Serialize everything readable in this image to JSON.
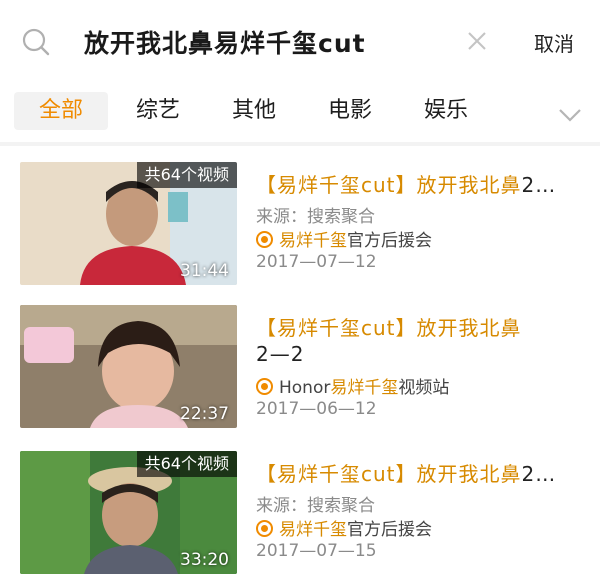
{
  "search": {
    "query": "放开我北鼻易烊千玺cut",
    "cancel_label": "取消"
  },
  "tabs": [
    {
      "label": "全部",
      "active": true
    },
    {
      "label": "综艺",
      "active": false
    },
    {
      "label": "其他",
      "active": false
    },
    {
      "label": "电影",
      "active": false
    },
    {
      "label": "娱乐",
      "active": false
    }
  ],
  "results": [
    {
      "count_badge": "共64个视频",
      "duration": "31:44",
      "title_tag": "【易烊千玺cut】",
      "title_hl": "放开我北鼻",
      "title_rest": "2…",
      "source": "来源：搜索聚合",
      "uploader_hl": "易烊千玺",
      "uploader_rest": "官方后援会",
      "date": "2017—07—12"
    },
    {
      "count_badge": "",
      "duration": "22:37",
      "title_tag": "【易烊千玺cut】",
      "title_hl": "放开我北鼻",
      "title_rest": "2—2",
      "uploader_prefix": "Honor",
      "uploader_hl": "易烊千玺",
      "uploader_rest": "视频站",
      "date": "2017—06—12"
    },
    {
      "count_badge": "共64个视频",
      "duration": "33:20",
      "title_tag": "【易烊千玺cut】",
      "title_hl": "放开我北鼻",
      "title_rest": "2…",
      "source": "来源：搜索聚合",
      "uploader_hl": "易烊千玺",
      "uploader_rest": "官方后援会",
      "date": "2017—07—15"
    }
  ],
  "colors": {
    "accent": "#f08b00",
    "highlight": "#d78a00"
  }
}
